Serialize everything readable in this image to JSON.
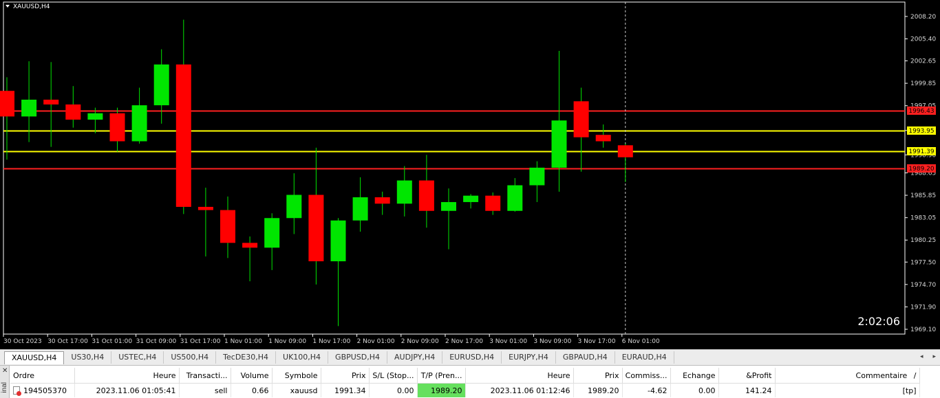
{
  "colors": {
    "chart_background": "#000000",
    "bull_candle": "#00e600",
    "bear_candle": "#ff0000",
    "wick": "#00e600",
    "red_level": "#ff2020",
    "yellow_level": "#ffff00",
    "tp_highlight": "#66e05e"
  },
  "chart_data": {
    "type": "candlestick",
    "title": "XAUUSD,H4",
    "symbol": "XAUUSD",
    "timeframe": "H4",
    "countdown": "2:02:06",
    "ylim": [
      1968.5,
      2010.0
    ],
    "y_ticks": [
      "2008.20",
      "2005.40",
      "2002.65",
      "1999.85",
      "1997.05",
      "1993.95",
      "1990.90",
      "1988.65",
      "1985.85",
      "1983.05",
      "1980.25",
      "1977.50",
      "1974.70",
      "1971.90",
      "1969.10"
    ],
    "x_ticks": [
      {
        "index": 0,
        "label": "30 Oct 2023"
      },
      {
        "index": 2,
        "label": "30 Oct 17:00"
      },
      {
        "index": 4,
        "label": "31 Oct 01:00"
      },
      {
        "index": 6,
        "label": "31 Oct 09:00"
      },
      {
        "index": 8,
        "label": "31 Oct 17:00"
      },
      {
        "index": 10,
        "label": "1 Nov 01:00"
      },
      {
        "index": 12,
        "label": "1 Nov 09:00"
      },
      {
        "index": 14,
        "label": "1 Nov 17:00"
      },
      {
        "index": 16,
        "label": "2 Nov 01:00"
      },
      {
        "index": 18,
        "label": "2 Nov 09:00"
      },
      {
        "index": 20,
        "label": "2 Nov 17:00"
      },
      {
        "index": 22,
        "label": "3 Nov 01:00"
      },
      {
        "index": 24,
        "label": "3 Nov 09:00"
      },
      {
        "index": 26,
        "label": "3 Nov 17:00"
      },
      {
        "index": 28,
        "label": "6 Nov 01:00"
      }
    ],
    "candles": [
      {
        "o": 1998.9,
        "h": 2000.6,
        "l": 1990.3,
        "c": 1995.7
      },
      {
        "o": 1995.7,
        "h": 2002.6,
        "l": 1992.5,
        "c": 1997.8
      },
      {
        "o": 1997.8,
        "h": 2002.5,
        "l": 1991.9,
        "c": 1997.2
      },
      {
        "o": 1997.2,
        "h": 1999.5,
        "l": 1994.3,
        "c": 1995.3
      },
      {
        "o": 1995.3,
        "h": 1996.8,
        "l": 1993.6,
        "c": 1996.1
      },
      {
        "o": 1996.1,
        "h": 1996.8,
        "l": 1991.3,
        "c": 1992.6
      },
      {
        "o": 1992.6,
        "h": 1999.3,
        "l": 1992.3,
        "c": 1997.1
      },
      {
        "o": 1997.1,
        "h": 2004.1,
        "l": 1994.8,
        "c": 2002.2
      },
      {
        "o": 2002.2,
        "h": 2007.8,
        "l": 1983.5,
        "c": 1984.4
      },
      {
        "o": 1984.4,
        "h": 1986.8,
        "l": 1978.2,
        "c": 1984.0
      },
      {
        "o": 1984.0,
        "h": 1985.7,
        "l": 1978.0,
        "c": 1979.9
      },
      {
        "o": 1979.9,
        "h": 1980.7,
        "l": 1975.1,
        "c": 1979.3
      },
      {
        "o": 1979.3,
        "h": 1983.6,
        "l": 1976.5,
        "c": 1983.0
      },
      {
        "o": 1983.0,
        "h": 1988.6,
        "l": 1981.0,
        "c": 1985.9
      },
      {
        "o": 1985.9,
        "h": 1991.8,
        "l": 1974.7,
        "c": 1977.6
      },
      {
        "o": 1977.6,
        "h": 1983.0,
        "l": 1969.5,
        "c": 1982.7
      },
      {
        "o": 1982.7,
        "h": 1988.1,
        "l": 1981.3,
        "c": 1985.6
      },
      {
        "o": 1985.6,
        "h": 1986.3,
        "l": 1983.4,
        "c": 1984.8
      },
      {
        "o": 1984.8,
        "h": 1989.5,
        "l": 1983.2,
        "c": 1987.7
      },
      {
        "o": 1987.7,
        "h": 1990.9,
        "l": 1981.8,
        "c": 1983.9
      },
      {
        "o": 1983.9,
        "h": 1986.7,
        "l": 1979.1,
        "c": 1985.0
      },
      {
        "o": 1985.0,
        "h": 1986.0,
        "l": 1984.2,
        "c": 1985.8
      },
      {
        "o": 1985.8,
        "h": 1986.2,
        "l": 1983.4,
        "c": 1983.9
      },
      {
        "o": 1983.9,
        "h": 1988.0,
        "l": 1983.8,
        "c": 1987.1
      },
      {
        "o": 1987.1,
        "h": 1990.1,
        "l": 1985.0,
        "c": 1989.3
      },
      {
        "o": 1989.3,
        "h": 2003.9,
        "l": 1986.3,
        "c": 1995.2
      },
      {
        "o": 1997.6,
        "h": 1999.3,
        "l": 1988.8,
        "c": 1993.1
      },
      {
        "o": 1993.4,
        "h": 1994.7,
        "l": 1991.8,
        "c": 1992.6
      },
      {
        "o": 1992.1,
        "h": 1992.3,
        "l": 1987.5,
        "c": 1990.6
      }
    ],
    "levels": [
      {
        "value": 1996.43,
        "label": "1996.43",
        "color": "#ff2020",
        "label_bg": "#ff2020",
        "label_fg": "#000000"
      },
      {
        "value": 1993.95,
        "label": "1993.95",
        "color": "#ffff00",
        "label_bg": "#ffff00",
        "label_fg": "#000000"
      },
      {
        "value": 1991.39,
        "label": "1991.39",
        "color": "#ffff00",
        "label_bg": "#ffff00",
        "label_fg": "#000000"
      },
      {
        "value": 1989.2,
        "label": "1989.20",
        "color": "#ff2020",
        "label_bg": "#ff2020",
        "label_fg": "#000000"
      }
    ],
    "grid": false,
    "crosshair_vertical_index": 28
  },
  "tabs": [
    {
      "label": "XAUUSD,H4",
      "active": true
    },
    {
      "label": "US30,H4"
    },
    {
      "label": "USTEC,H4"
    },
    {
      "label": "US500,H4"
    },
    {
      "label": "TecDE30,H4"
    },
    {
      "label": "UK100,H4"
    },
    {
      "label": "GBPUSD,H4"
    },
    {
      "label": "AUDJPY,H4"
    },
    {
      "label": "EURUSD,H4"
    },
    {
      "label": "EURJPY,H4"
    },
    {
      "label": "GBPAUD,H4"
    },
    {
      "label": "EURAUD,H4"
    }
  ],
  "tab_scroll": {
    "left": "◂",
    "right": "▸"
  },
  "terminal": {
    "close_glyph": "✕",
    "side_label": "inal",
    "columns": [
      "Ordre",
      "Heure",
      "Transacti...",
      "Volume",
      "Symbole",
      "Prix",
      "S/L (Stop...",
      "T/P (Pren...",
      "Heure",
      "Prix",
      "Commiss...",
      "Echange",
      "&Profit",
      "Commentaire"
    ],
    "sort_indicator": "/",
    "row": {
      "order": "194505370",
      "open_time": "2023.11.06 01:05:41",
      "type": "sell",
      "volume": "0.66",
      "symbol": "xauusd",
      "open_price": "1991.34",
      "sl": "0.00",
      "tp": "1989.20",
      "close_time": "2023.11.06 01:12:46",
      "close_price": "1989.20",
      "commission": "-4.62",
      "swap": "0.00",
      "profit": "141.24",
      "comment": "[tp]"
    }
  }
}
